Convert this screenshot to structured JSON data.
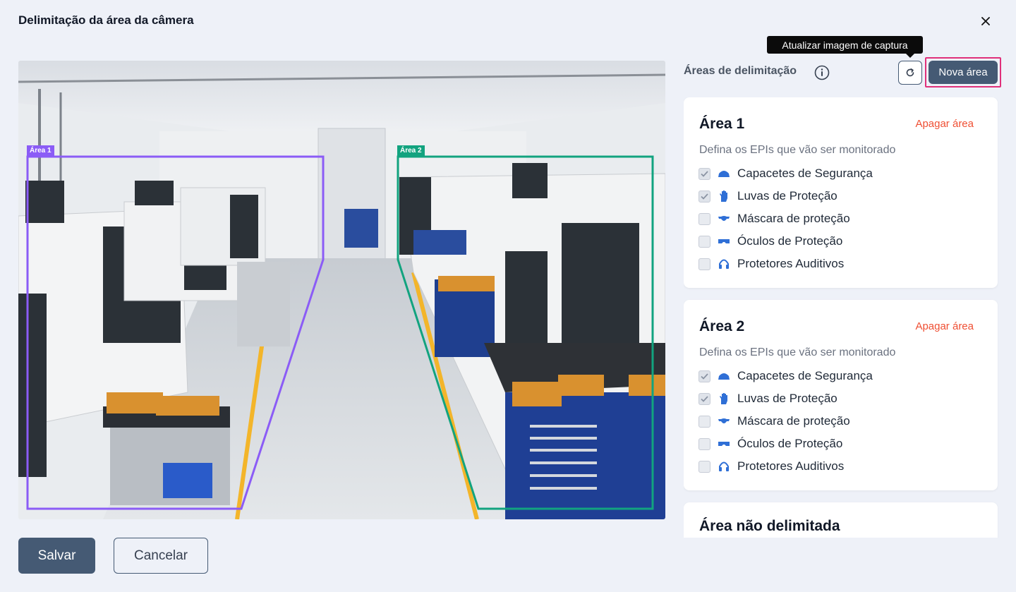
{
  "modal": {
    "title": "Delimitação da área da câmera",
    "close_icon": "close-icon"
  },
  "camera": {
    "zones": [
      {
        "label": "Área 1",
        "color": "#8b5cf6"
      },
      {
        "label": "Área 2",
        "color": "#12a37f"
      }
    ]
  },
  "actions": {
    "save_label": "Salvar",
    "cancel_label": "Cancelar"
  },
  "panel": {
    "title": "Áreas de delimitação",
    "tooltip": "Atualizar imagem de captura",
    "new_area_label": "Nova área",
    "areas": [
      {
        "title": "Área 1",
        "delete_label": "Apagar área",
        "subtitle": "Defina os EPIs que vão ser monitorado",
        "items": [
          {
            "label": "Capacetes de Segurança",
            "checked": true,
            "icon": "helmet-icon"
          },
          {
            "label": "Luvas de Proteção",
            "checked": true,
            "icon": "glove-icon"
          },
          {
            "label": "Máscara de proteção",
            "checked": false,
            "icon": "mask-icon"
          },
          {
            "label": "Óculos de Proteção",
            "checked": false,
            "icon": "goggles-icon"
          },
          {
            "label": "Protetores Auditivos",
            "checked": false,
            "icon": "headphones-icon"
          }
        ]
      },
      {
        "title": "Área 2",
        "delete_label": "Apagar área",
        "subtitle": "Defina os EPIs que vão ser monitorado",
        "items": [
          {
            "label": "Capacetes de Segurança",
            "checked": true,
            "icon": "helmet-icon"
          },
          {
            "label": "Luvas de Proteção",
            "checked": true,
            "icon": "glove-icon"
          },
          {
            "label": "Máscara de proteção",
            "checked": false,
            "icon": "mask-icon"
          },
          {
            "label": "Óculos de Proteção",
            "checked": false,
            "icon": "goggles-icon"
          },
          {
            "label": "Protetores Auditivos",
            "checked": false,
            "icon": "headphones-icon"
          }
        ]
      },
      {
        "title": "Área não delimitada"
      }
    ]
  },
  "colors": {
    "primary": "#455a74",
    "danger": "#ef4f33",
    "highlight": "#e0307a",
    "icon_blue": "#2f6fd6"
  }
}
